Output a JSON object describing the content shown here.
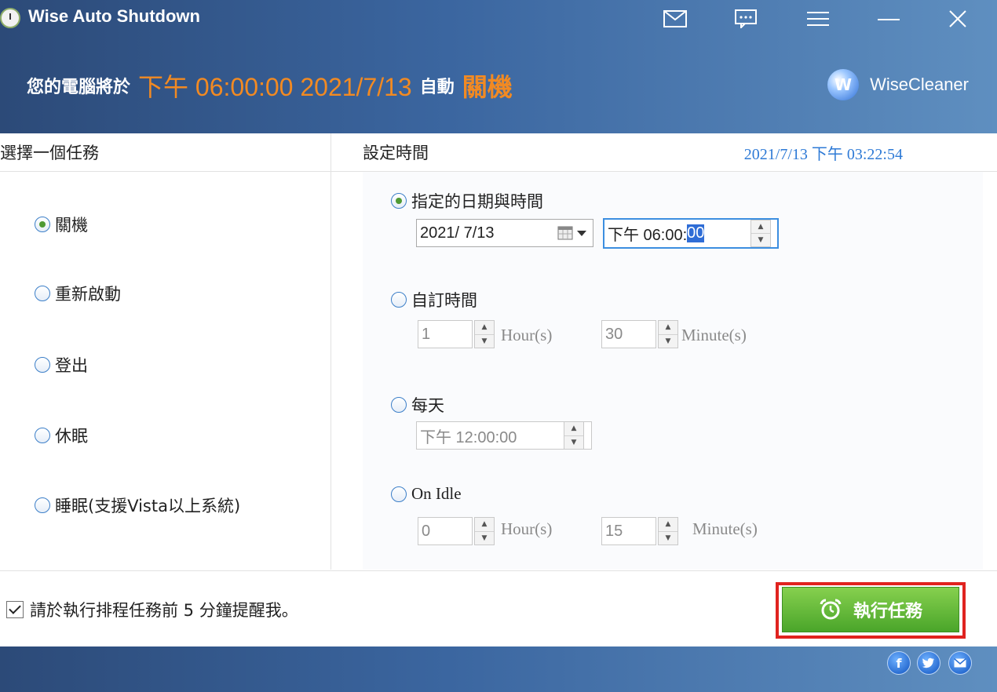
{
  "window": {
    "title": "Wise Auto Shutdown"
  },
  "status": {
    "prefix": "您的電腦將於",
    "scheduled_time": "下午 06:00:00 2021/7/13",
    "mid": "自動",
    "action": "關機"
  },
  "brand": {
    "logo_letter": "W",
    "name": "WiseCleaner"
  },
  "left": {
    "heading": "選擇一個任務",
    "tasks": [
      {
        "label": "關機",
        "checked": true
      },
      {
        "label": "重新啟動",
        "checked": false
      },
      {
        "label": "登出",
        "checked": false
      },
      {
        "label": "休眠",
        "checked": false
      },
      {
        "label": "睡眠(支援Vista以上系統)",
        "checked": false
      }
    ]
  },
  "right": {
    "heading": "設定時間",
    "current_time": "2021/7/13 下午 03:22:54",
    "specific": {
      "label": "指定的日期與時間",
      "date": "2021/  7/13",
      "time_prefix": "下午 06:00:",
      "time_selected": "00"
    },
    "custom": {
      "label": "自訂時間",
      "hours": "1",
      "hour_unit": "Hour(s)",
      "minutes": "30",
      "minute_unit": "Minute(s)"
    },
    "daily": {
      "label": "每天",
      "time": "下午 12:00:00"
    },
    "idle": {
      "label": "On Idle",
      "hours": "0",
      "hour_unit": "Hour(s)",
      "minutes": "15",
      "minute_unit": "Minute(s)"
    }
  },
  "bottom": {
    "reminder": "請於執行排程任務前 5 分鐘提醒我。",
    "run_label": "執行任務"
  },
  "social": {
    "facebook": "f"
  },
  "colors": {
    "header_dark": "#2c4a78",
    "header_light": "#5f8fc0",
    "accent_orange": "#f28a22",
    "time_blue": "#2e7ad6",
    "run_green": "#4aa52a",
    "highlight_red": "#e0231f"
  },
  "icons": {
    "titlebar": [
      "mail-icon",
      "feedback-icon",
      "menu-icon",
      "minimize-icon",
      "close-icon"
    ],
    "social": [
      "facebook-icon",
      "twitter-icon",
      "email-icon"
    ]
  }
}
